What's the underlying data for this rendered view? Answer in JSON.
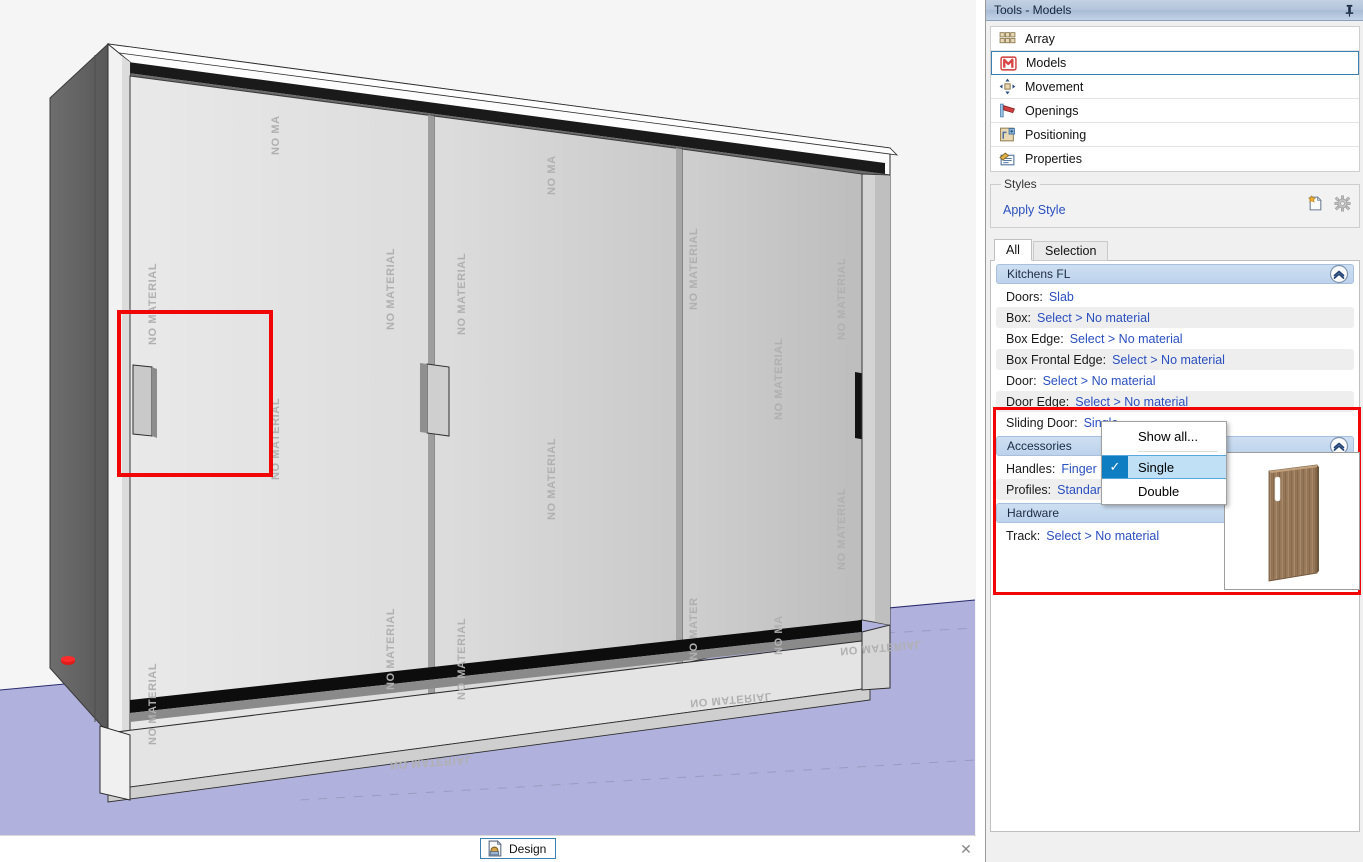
{
  "window": {
    "dock_title": "Tools - Models",
    "pin_icon": "pin-icon"
  },
  "tools": {
    "items": [
      {
        "label": "Array",
        "icon": "array-icon",
        "selected": false
      },
      {
        "label": "Models",
        "icon": "models-icon",
        "selected": true
      },
      {
        "label": "Movement",
        "icon": "movement-icon",
        "selected": false
      },
      {
        "label": "Openings",
        "icon": "openings-icon",
        "selected": false
      },
      {
        "label": "Positioning",
        "icon": "positioning-icon",
        "selected": false
      },
      {
        "label": "Properties",
        "icon": "properties-icon",
        "selected": false
      }
    ]
  },
  "styles": {
    "legend": "Styles",
    "apply_style_label": "Apply Style",
    "new_style_icon": "new-document-icon",
    "settings_icon": "gear-icon"
  },
  "tabs": {
    "all": "All",
    "selection": "Selection"
  },
  "properties": {
    "group_kitchens": "Kitchens FL",
    "rows_kitchens": [
      {
        "label": "Doors:",
        "value": "Slab"
      },
      {
        "label": "Box:",
        "value": "Select > No material"
      },
      {
        "label": "Box Edge:",
        "value": "Select > No material"
      },
      {
        "label": "Box Frontal Edge:",
        "value": "Select > No material"
      },
      {
        "label": "Door:",
        "value": "Select > No material"
      },
      {
        "label": "Door Edge:",
        "value": "Select > No material"
      },
      {
        "label": "Sliding Door:",
        "value": "Single"
      }
    ],
    "group_accessories": "Accessories",
    "rows_accessories": [
      {
        "label": "Handles:",
        "value": "Finger Pull"
      },
      {
        "label": "Profiles:",
        "value": "Standard"
      }
    ],
    "group_hardware": "Hardware",
    "rows_hardware": [
      {
        "label": "Track:",
        "value": "Select > No material"
      }
    ]
  },
  "dropdown": {
    "items": [
      {
        "label": "Show all...",
        "checked": false,
        "selected": false
      },
      {
        "label": "Single",
        "checked": true,
        "selected": true
      },
      {
        "label": "Double",
        "checked": false,
        "selected": false
      }
    ],
    "check_glyph": "✓"
  },
  "preview": {
    "name": "sliding-door-preview",
    "alt": "Wood sliding door with finger pull handle"
  },
  "bottom_bar": {
    "design_tab_label": "Design",
    "design_tab_icon": "design-document-icon",
    "close_label": "✕"
  },
  "viewport": {
    "material_watermark": "NO MATERIAL",
    "selection_highlight": "red-selection-rectangle"
  },
  "colors": {
    "accent_link": "#2a4fc0",
    "selection_red": "#f20505",
    "title_bar": "#b4c5db",
    "group_header": "#c6daf0",
    "floor": "#b0b2dd",
    "dropdown_selected": "#bfe0f5",
    "check_box": "#0f7dc2"
  }
}
